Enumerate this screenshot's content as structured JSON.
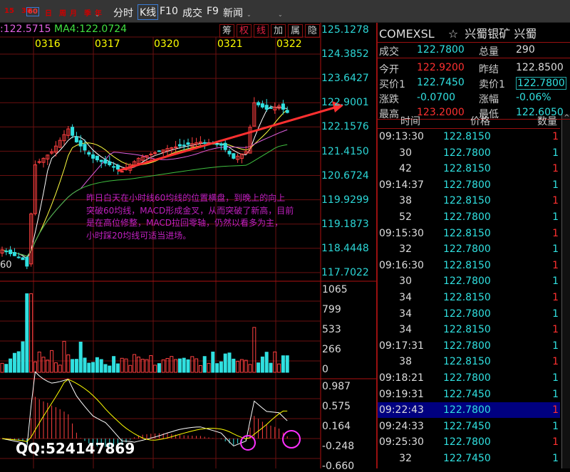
{
  "toolbar": {
    "periods": [
      "15",
      "30",
      "60",
      "日",
      "周",
      "月",
      "季",
      "年"
    ],
    "selected_period": "60",
    "tabs": [
      "分时",
      "K线",
      "F10",
      "成交",
      "F9",
      "新闻"
    ],
    "selected_tab": "K线"
  },
  "chart": {
    "ma_info": [
      {
        "text": ":122.5715",
        "color": "#e060e0"
      },
      {
        "text": "MA4:122.0724",
        "color": "#40e040"
      }
    ],
    "right_buttons": [
      "筹",
      "权",
      "线",
      "加",
      "属",
      "隐"
    ],
    "dates": [
      "0316",
      "0317",
      "0320",
      "0321",
      "0322"
    ],
    "price_axis": [
      "125.1278",
      "124.3852",
      "123.6427",
      "122.9001",
      "122.1576",
      "121.4150",
      "120.6724",
      "119.9299",
      "119.1873",
      "118.4448",
      "117.7022"
    ],
    "volume_axis": [
      "1065",
      "799",
      "533",
      "266",
      "0"
    ],
    "macd_axis": [
      "0.987",
      "0.575",
      "0.164",
      "-0.248",
      "-0.660"
    ],
    "left_label": "60",
    "annotation": [
      "昨日白天在小时线60均线的位置横盘，到晚上的向上",
      "突破60均线，MACD形成金叉，从而突破了新高，目前",
      "是在高位修整，MACD拉回零轴，仍然以看多为主，",
      "小时踩20均线可适当进场。"
    ],
    "watermark": "QQ:524147869",
    "price_keypoints": [
      [
        0,
        118.4
      ],
      [
        5,
        118.1
      ],
      [
        6,
        117.9
      ],
      [
        7,
        119.5
      ],
      [
        8,
        121.0
      ],
      [
        12,
        121.4
      ],
      [
        16,
        122.1
      ],
      [
        18,
        121.7
      ],
      [
        22,
        121.2
      ],
      [
        26,
        121.0
      ],
      [
        29,
        120.8
      ],
      [
        33,
        121.2
      ],
      [
        40,
        121.5
      ],
      [
        48,
        121.7
      ],
      [
        53,
        121.6
      ],
      [
        56,
        121.2
      ],
      [
        59,
        121.4
      ],
      [
        61,
        122.9
      ],
      [
        64,
        122.7
      ],
      [
        67,
        122.8
      ],
      [
        69,
        122.6
      ]
    ],
    "colors": {
      "up": "#ff4040",
      "down": "#30e0e0",
      "grid": "#6a1010",
      "accent": "#9a1010"
    }
  },
  "quote": {
    "symbol": "COMEXSL",
    "name": "兴蜀银矿 兴蜀",
    "fields": [
      {
        "label": "成交",
        "value": "122.7800",
        "color": "#30e0e0",
        "label2": "总量",
        "value2": "290",
        "color2": "#ddd"
      },
      {
        "label": "今开",
        "value": "122.9200",
        "color": "#ff3030",
        "label2": "昨结",
        "value2": "122.8500",
        "color2": "#ddd"
      },
      {
        "label": "买价1",
        "value": "122.7450",
        "color": "#30e0e0",
        "label2": "卖价1",
        "value2": "122.7800",
        "color2": "#30e0e0"
      },
      {
        "label": "涨跌",
        "value": "-0.0700",
        "color": "#30e0e0",
        "label2": "涨幅",
        "value2": "-0.06%",
        "color2": "#30e0e0"
      },
      {
        "label": "最高",
        "value": "123.2000",
        "color": "#ff3030",
        "label2": "最低",
        "value2": "122.6050",
        "color2": "#30e0e0"
      }
    ],
    "headers": [
      "时间",
      "价格",
      "数量"
    ],
    "ticks": [
      [
        "09:13:30",
        "122.8150",
        "1",
        "r"
      ],
      [
        "30",
        "122.7800",
        "1",
        "c"
      ],
      [
        "42",
        "122.8150",
        "1",
        "r"
      ],
      [
        "09:14:37",
        "122.7800",
        "1",
        "c"
      ],
      [
        "38",
        "122.8150",
        "1",
        "r"
      ],
      [
        "52",
        "122.7800",
        "1",
        "c"
      ],
      [
        "09:15:30",
        "122.8150",
        "1",
        "r"
      ],
      [
        "32",
        "122.7800",
        "1",
        "c"
      ],
      [
        "09:16:30",
        "122.8150",
        "1",
        "r"
      ],
      [
        "30",
        "122.7800",
        "1",
        "c"
      ],
      [
        "34",
        "122.8150",
        "1",
        "r"
      ],
      [
        "34",
        "122.7800",
        "1",
        "c"
      ],
      [
        "34",
        "122.8150",
        "1",
        "r"
      ],
      [
        "09:17:31",
        "122.7800",
        "1",
        "c"
      ],
      [
        "38",
        "122.8150",
        "1",
        "r"
      ],
      [
        "09:18:21",
        "122.7800",
        "1",
        "c"
      ],
      [
        "09:19:31",
        "122.7450",
        "1",
        "c"
      ],
      [
        "09:22:43",
        "122.7800",
        "1",
        "r"
      ],
      [
        "09:24:33",
        "122.7450",
        "1",
        "c"
      ],
      [
        "09:25:30",
        "122.7800",
        "1",
        "r"
      ],
      [
        "32",
        "122.7450",
        "1",
        "c"
      ]
    ],
    "selected_tick": 17
  }
}
